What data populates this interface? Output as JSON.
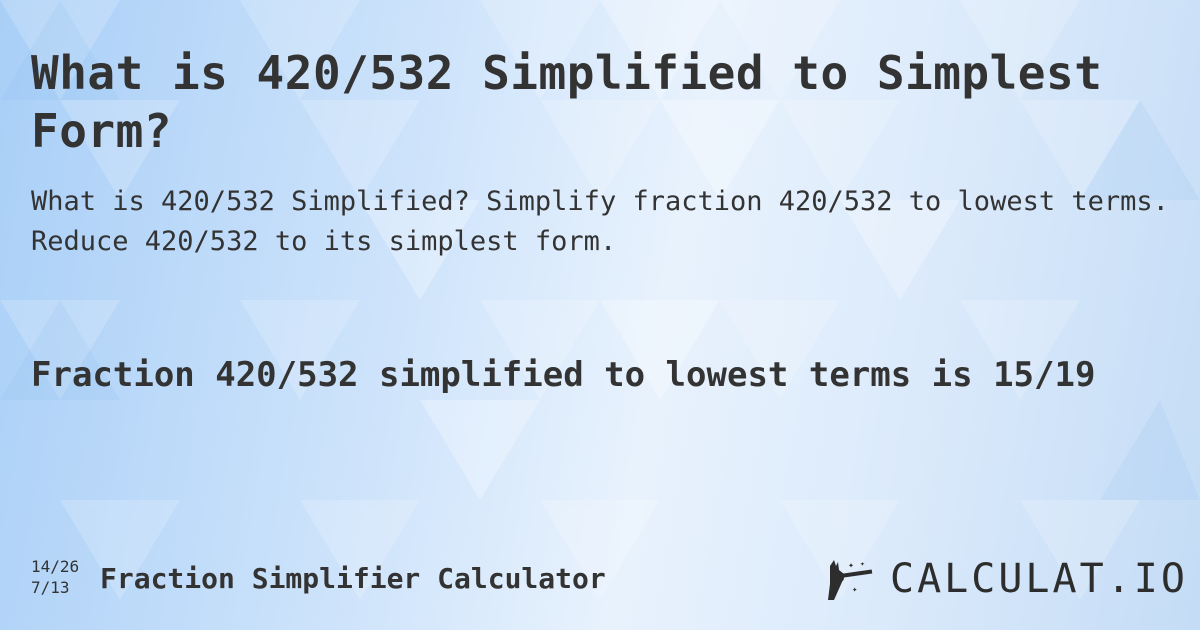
{
  "title": "What is 420/532 Simplified to Simplest Form?",
  "subtitle": "What is 420/532 Simplified? Simplify fraction 420/532 to lowest terms. Reduce 420/532 to its simplest form.",
  "result": "Fraction 420/532 simplified to lowest terms is 15/19",
  "footer": {
    "fraction_top": "14/26",
    "fraction_bottom": "7/13",
    "calculator_name": "Fraction Simplifier Calculator"
  },
  "logo": {
    "icon": "magic-wand-hand-icon",
    "text": "CALCULAT.IO"
  },
  "colors": {
    "text": "#333333",
    "background_light": "#e8f2fd",
    "background_blue": "#a9cff7"
  }
}
